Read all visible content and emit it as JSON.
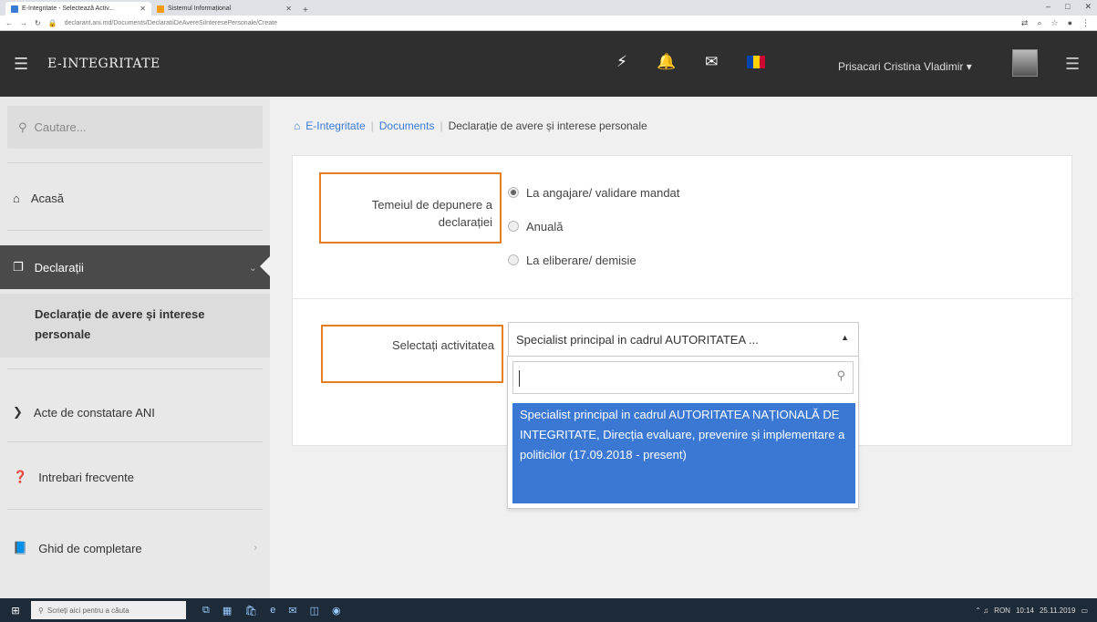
{
  "browser": {
    "tabs": [
      {
        "title": "E-Integritate - Selectează Activ..."
      },
      {
        "title": "Sistemul Informațional"
      }
    ],
    "address": "declarant.ani.md/Documents/DeclaratiiDeAvereSiInteresePersonale/Create",
    "window_controls": [
      "–",
      "□",
      "✕"
    ]
  },
  "header": {
    "brand": "E-INTEGRITATE",
    "icons": [
      "magic-icon",
      "bell-icon",
      "envelope-icon",
      "flag-icon"
    ],
    "user_name": "Prisacari Cristina Vladimir"
  },
  "sidebar": {
    "search_placeholder": "Cautare...",
    "items": [
      {
        "label": "Acasă",
        "icon": "home-icon"
      },
      {
        "label": "Declarații",
        "icon": "copy-icon",
        "active": true
      },
      {
        "label": "Acte de constatare ANI",
        "icon": "chevron-right-icon"
      },
      {
        "label": "Intrebari frecvente",
        "icon": "question-icon"
      },
      {
        "label": "Ghid de completare",
        "icon": "book-icon"
      }
    ],
    "submenu_item": "Declarație de avere și interese personale"
  },
  "breadcrumb": {
    "home": "E-Integritate",
    "documents": "Documents",
    "current": "Declarație de avere și interese personale"
  },
  "form": {
    "basis_label": "Temeiul de depunere a declarației",
    "options": [
      {
        "label": "La angajare/ validare mandat",
        "checked": true
      },
      {
        "label": "Anuală",
        "checked": false
      },
      {
        "label": "La eliberare/ demisie",
        "checked": false
      }
    ],
    "activity_label": "Selectați activitatea",
    "select_value": "Specialist principal in cadrul AUTORITATEA ...",
    "dropdown_search": "",
    "dropdown_option": "Specialist principal in cadrul AUTORITATEA NAȚIONALĂ DE INTEGRITATE, Direcția evaluare, prevenire și implementare a politicilor (17.09.2018 - present)"
  },
  "taskbar": {
    "search_placeholder": "Scrieți aici pentru a căuta",
    "lang": "RON",
    "time": "10:14",
    "date": "25.11.2019"
  },
  "colors": {
    "header_bg": "#2f2f2f",
    "accent": "#3a78d3",
    "highlight_border": "#e67e22"
  }
}
